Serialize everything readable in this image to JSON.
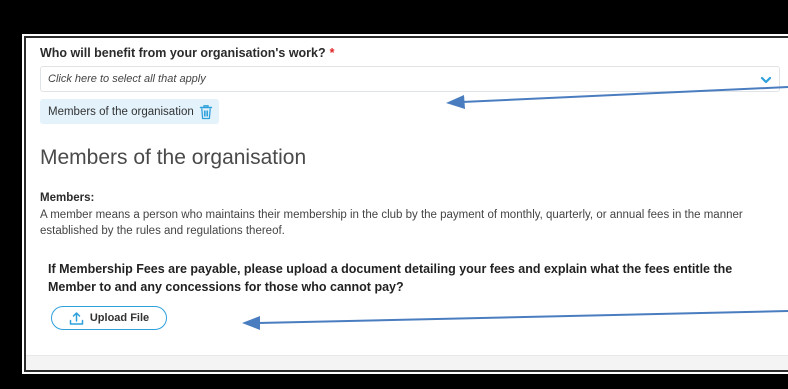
{
  "form": {
    "question_label": "Who will benefit from your organisation's work?",
    "required_marker": "*",
    "select_placeholder": "Click here to select all that apply",
    "selected_chip": "Members of the organisation",
    "section_title": "Members of the organisation",
    "members_label": "Members:",
    "members_description": "A member means a person who maintains their membership in the club by the payment of monthly, quarterly, or annual fees in the manner established by the rules and regulations thereof.",
    "fees_question": "If Membership Fees are payable, please upload a document detailing your fees and explain what the fees entitle the Member to and any concessions for those who cannot pay?",
    "upload_button_label": "Upload File"
  },
  "icons": {
    "dropdown": "chevron-down-icon",
    "remove_chip": "trash-icon",
    "upload": "upload-icon"
  },
  "colors": {
    "accent": "#2ea0dc",
    "chip_background": "#e3f2fb",
    "required": "#e02424",
    "annotation_arrow": "#4a7dbf"
  }
}
